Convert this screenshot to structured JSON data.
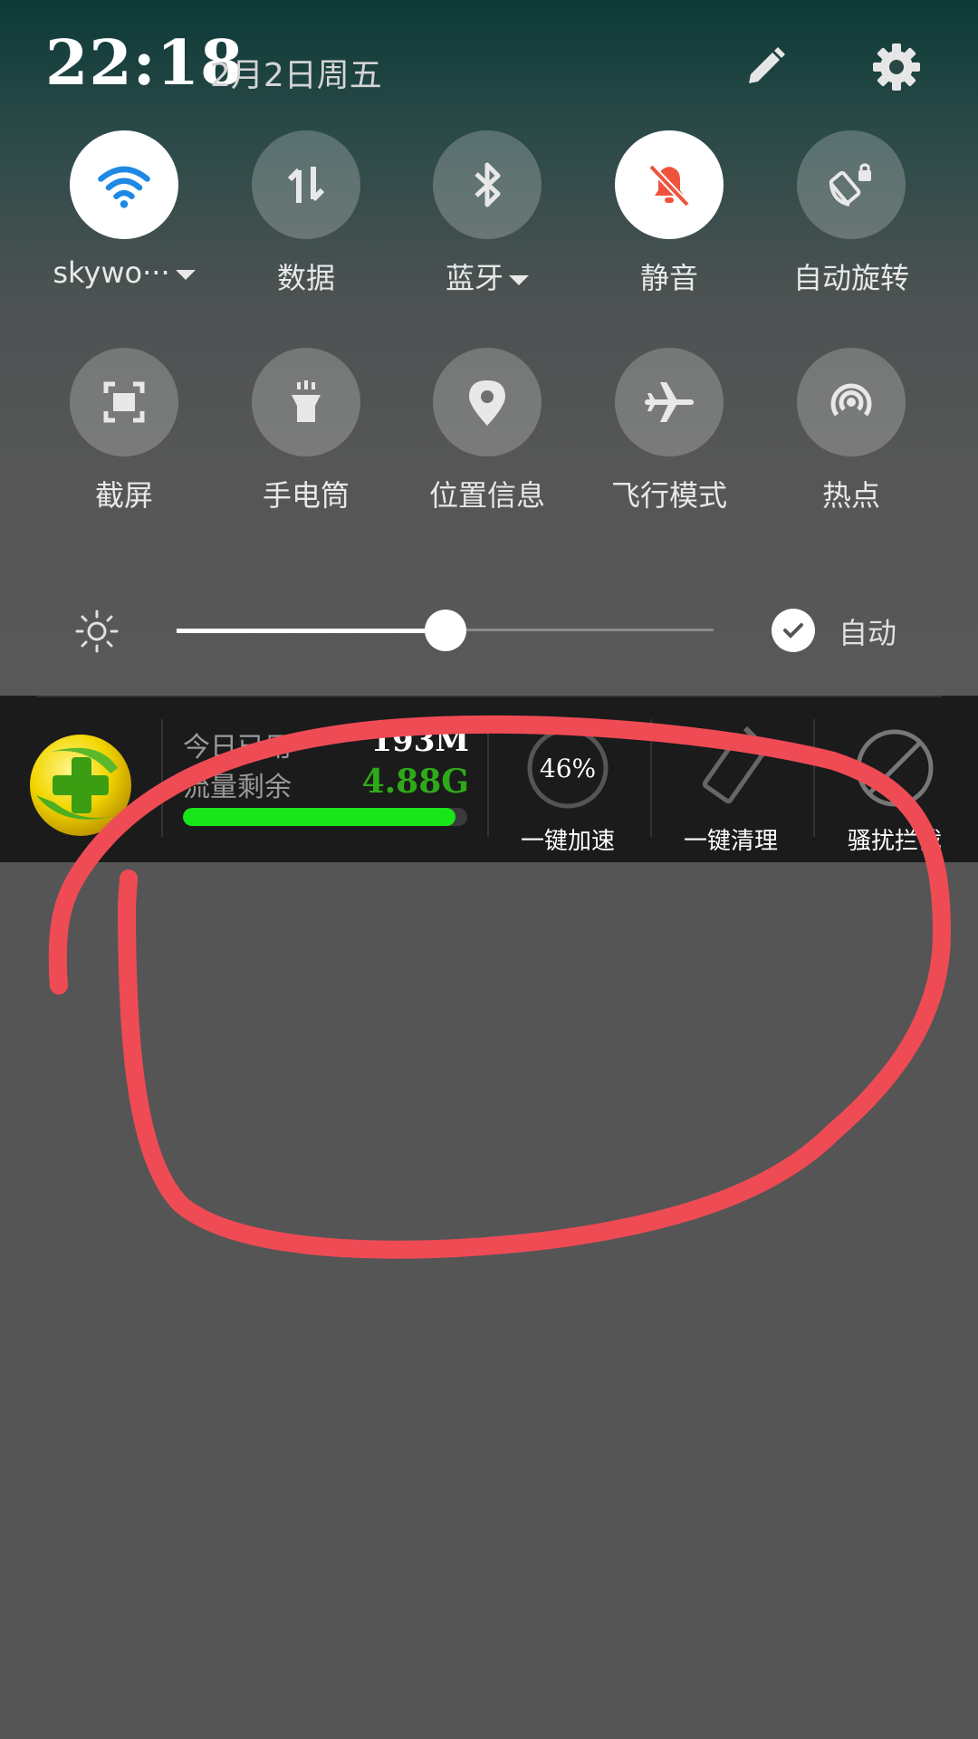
{
  "status": {
    "time": "22:18",
    "date": "2月2日周五"
  },
  "quick_tiles": [
    {
      "id": "wifi",
      "label": "skywo···",
      "icon": "wifi-icon",
      "on": true,
      "dropdown": true
    },
    {
      "id": "data",
      "label": "数据",
      "icon": "data-transfer-icon",
      "on": false,
      "dropdown": false
    },
    {
      "id": "bluetooth",
      "label": "蓝牙",
      "icon": "bluetooth-icon",
      "on": false,
      "dropdown": true
    },
    {
      "id": "mute",
      "label": "静音",
      "icon": "bell-off-icon",
      "on": true,
      "dropdown": false
    },
    {
      "id": "autorotate",
      "label": "自动旋转",
      "icon": "rotate-lock-icon",
      "on": false,
      "dropdown": false
    },
    {
      "id": "screenshot",
      "label": "截屏",
      "icon": "screenshot-icon",
      "on": false,
      "dropdown": false
    },
    {
      "id": "flashlight",
      "label": "手电筒",
      "icon": "flashlight-icon",
      "on": false,
      "dropdown": false
    },
    {
      "id": "location",
      "label": "位置信息",
      "icon": "location-pin-icon",
      "on": false,
      "dropdown": false
    },
    {
      "id": "airplane",
      "label": "飞行模式",
      "icon": "airplane-icon",
      "on": false,
      "dropdown": false
    },
    {
      "id": "hotspot",
      "label": "热点",
      "icon": "hotspot-icon",
      "on": false,
      "dropdown": false
    }
  ],
  "brightness": {
    "level": 0.5,
    "auto_label": "自动",
    "auto_checked": true
  },
  "widget": {
    "today_used_label": "今日已用",
    "today_used_value": "193M",
    "remaining_label": "流量剩余",
    "remaining_value": "4.88G",
    "remaining_fraction": 0.96,
    "speedup_percent": "46%",
    "speedup_label": "一键加速",
    "clean_label": "一键清理",
    "block_label": "骚扰拦截"
  },
  "colors": {
    "accent_blue": "#1e88e5",
    "mute_red": "#f0533d",
    "traffic_green": "#19e619",
    "remaining_text_green": "#2eaa18",
    "annotation_red": "#ef4b55"
  }
}
